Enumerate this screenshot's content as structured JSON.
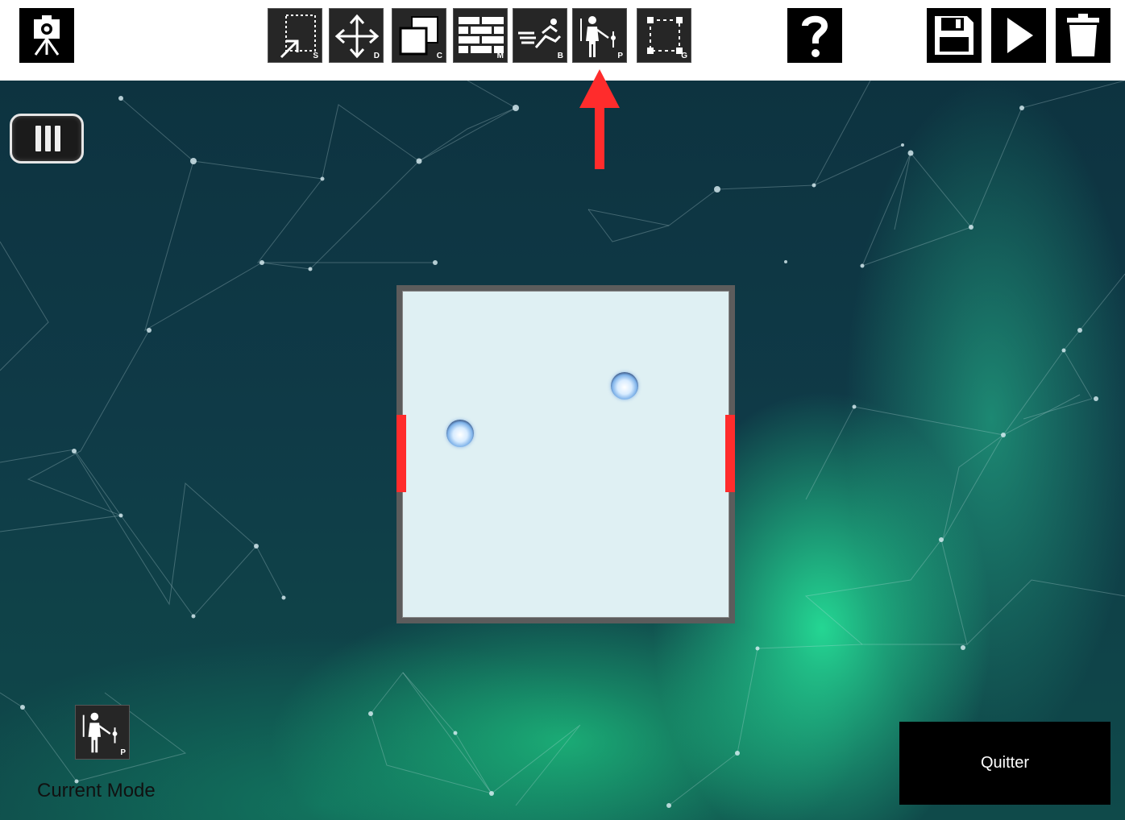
{
  "toolbar": {
    "left_tool": {
      "icon": "camera-on-tripod-icon"
    },
    "tools": [
      {
        "icon": "selection-cursor-icon",
        "letter": "S"
      },
      {
        "icon": "move-arrows-icon",
        "letter": "D"
      },
      {
        "icon": "copy-squares-icon",
        "letter": "C"
      },
      {
        "icon": "brick-wall-icon",
        "letter": "M"
      },
      {
        "icon": "running-person-icon",
        "letter": "B"
      },
      {
        "icon": "person-with-items-icon",
        "letter": "P",
        "selected": true
      },
      {
        "icon": "group-nodes-icon",
        "letter": "G"
      }
    ],
    "help": {
      "icon": "question-mark-icon"
    },
    "right_tools": [
      {
        "icon": "save-floppy-icon"
      },
      {
        "icon": "play-icon"
      },
      {
        "icon": "trash-icon"
      }
    ]
  },
  "sidebar_toggle": {
    "icon": "menu-bars-icon"
  },
  "room": {
    "wall_color": "#5c5c5c",
    "floor_color": "#dff0f3",
    "door_color": "#ff2c2c"
  },
  "annotation": {
    "icon": "red-up-arrow-icon",
    "color": "#ff2c2c"
  },
  "current_mode": {
    "icon": "person-with-items-icon",
    "letter": "P",
    "label": "Current Mode"
  },
  "quit_button": {
    "label": "Quitter"
  }
}
